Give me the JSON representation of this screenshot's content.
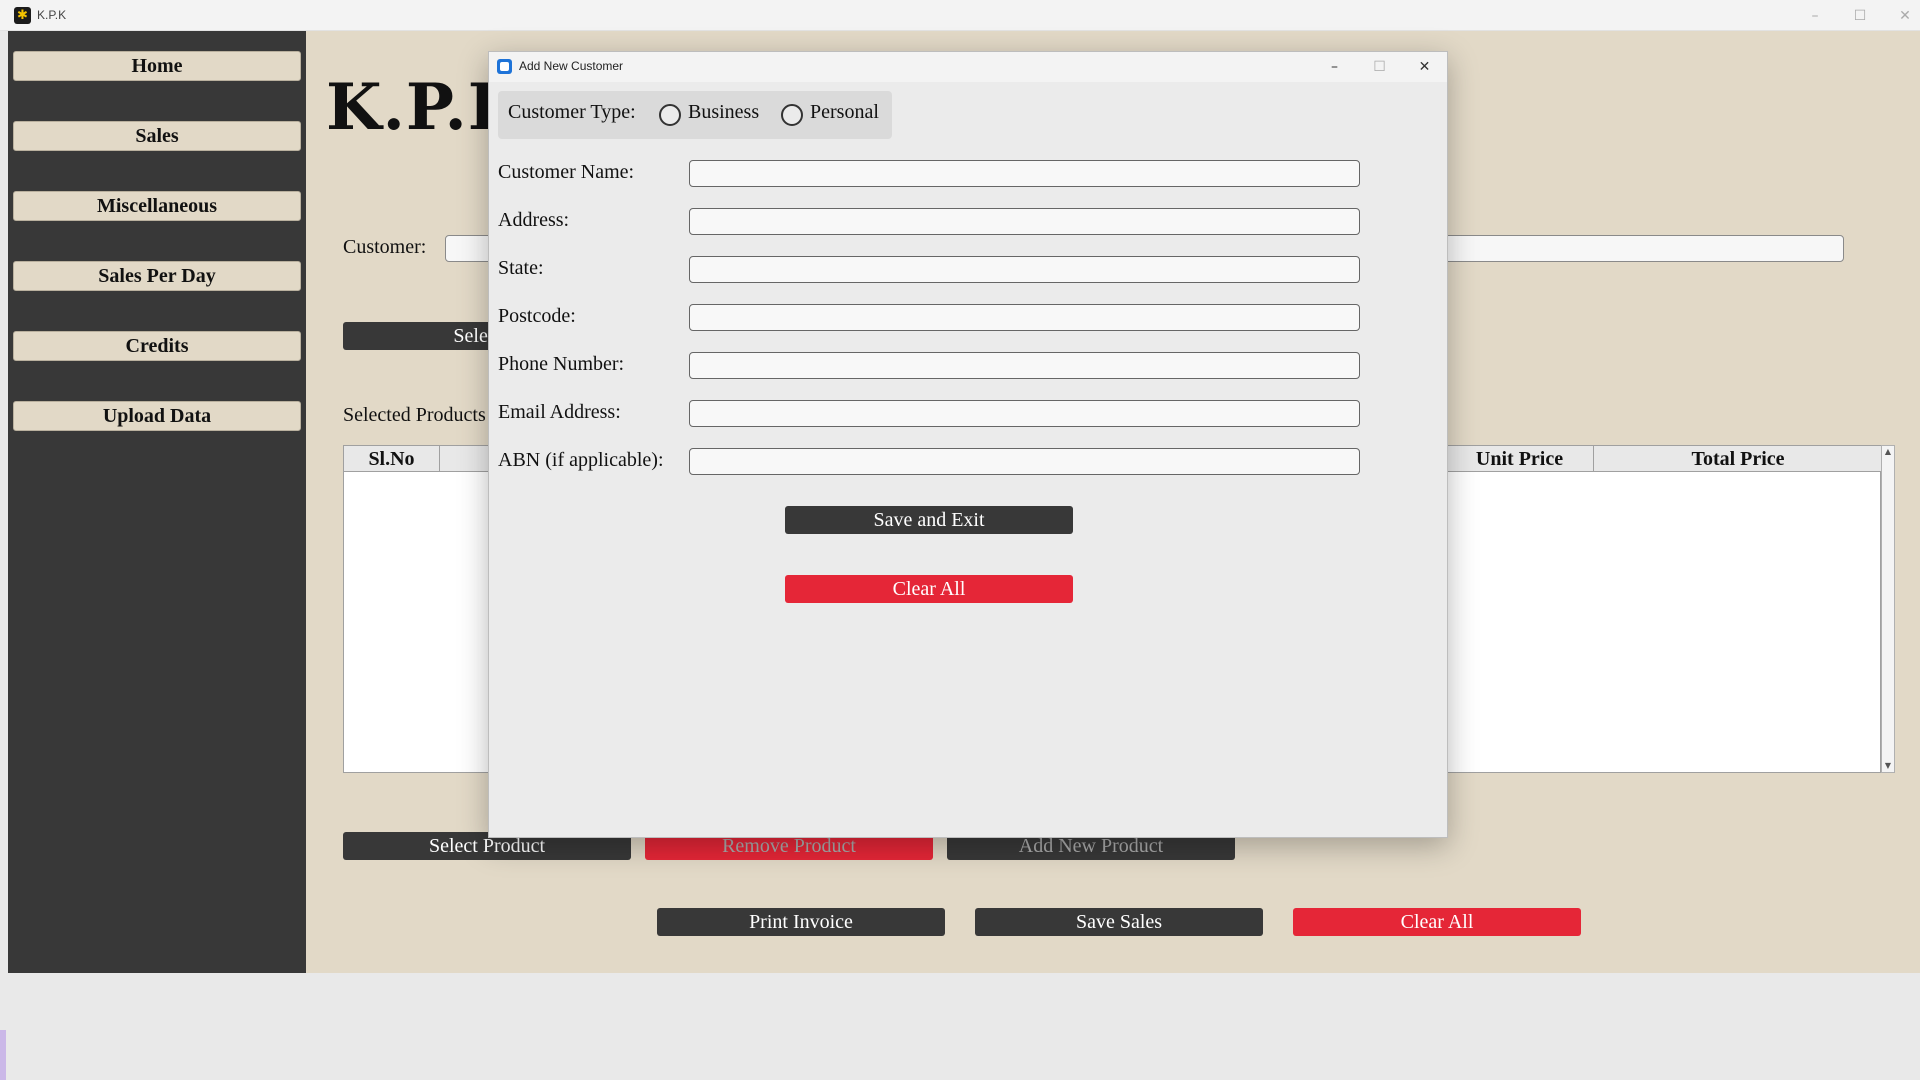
{
  "window": {
    "title": "K.P.K",
    "controls": {
      "minimize": "–",
      "maximize": "☐",
      "close": "✕"
    }
  },
  "sidebar": {
    "items": [
      {
        "label": "Home"
      },
      {
        "label": "Sales"
      },
      {
        "label": "Miscellaneous"
      },
      {
        "label": "Sales Per Day"
      },
      {
        "label": "Credits"
      },
      {
        "label": "Upload Data"
      }
    ]
  },
  "main": {
    "brand": "K.P.K",
    "customer_label": "Customer:",
    "select_customer_label": "Select C",
    "selected_products_label": "Selected Products",
    "table": {
      "headers": {
        "sl_no": "Sl.No",
        "unit_price": "Unit Price",
        "total_price": "Total Price"
      },
      "rows": []
    },
    "buttons": {
      "select_product": "Select Product",
      "remove_product": "Remove Product",
      "add_new_product": "Add New Product",
      "print_invoice": "Print Invoice",
      "save_sales": "Save Sales",
      "clear_all": "Clear All"
    }
  },
  "dialog": {
    "title": "Add New Customer",
    "controls": {
      "minimize": "–",
      "maximize": "☐",
      "close": "✕"
    },
    "customer_type_label": "Customer Type:",
    "options": {
      "business": "Business",
      "personal": "Personal"
    },
    "fields": {
      "customer_name": {
        "label": "Customer Name:",
        "value": ""
      },
      "address": {
        "label": "Address:",
        "value": ""
      },
      "state": {
        "label": "State:",
        "value": ""
      },
      "postcode": {
        "label": "Postcode:",
        "value": ""
      },
      "phone_number": {
        "label": "Phone Number:",
        "value": ""
      },
      "email_address": {
        "label": "Email Address:",
        "value": ""
      },
      "abn": {
        "label": "ABN (if applicable):",
        "value": ""
      }
    },
    "save_and_exit": "Save and Exit",
    "clear_all": "Clear All"
  },
  "colors": {
    "sidebar_bg": "#383838",
    "content_bg": "#e2d9c7",
    "nav_button_bg": "#e2d9c7",
    "dark_button": "#383838",
    "danger_button": "#e52637",
    "dialog_bg": "#ebebeb"
  },
  "icons": {
    "app_icon": "app-logo-icon",
    "dialog_icon": "window-icon"
  }
}
